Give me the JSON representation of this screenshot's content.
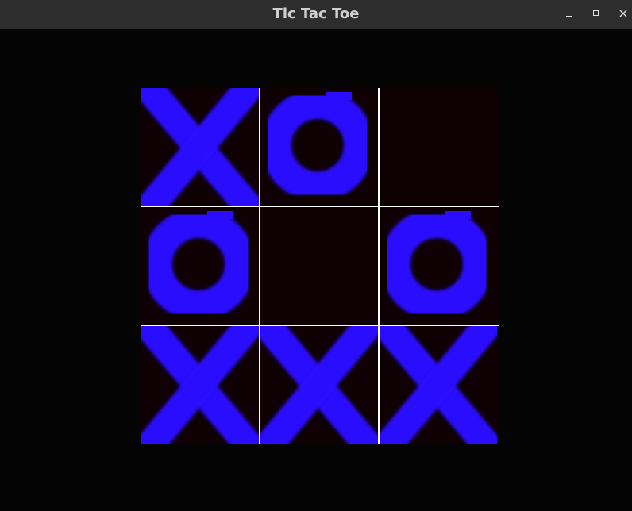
{
  "window": {
    "title": "Tic Tac Toe"
  },
  "board": {
    "cells": [
      [
        "X",
        "O",
        ""
      ],
      [
        "O",
        "",
        "O"
      ],
      [
        "X",
        "X",
        "X"
      ]
    ],
    "mark_color": "#2a10ff",
    "grid_color": "#ffffff",
    "cell_background": "#0e0003"
  }
}
